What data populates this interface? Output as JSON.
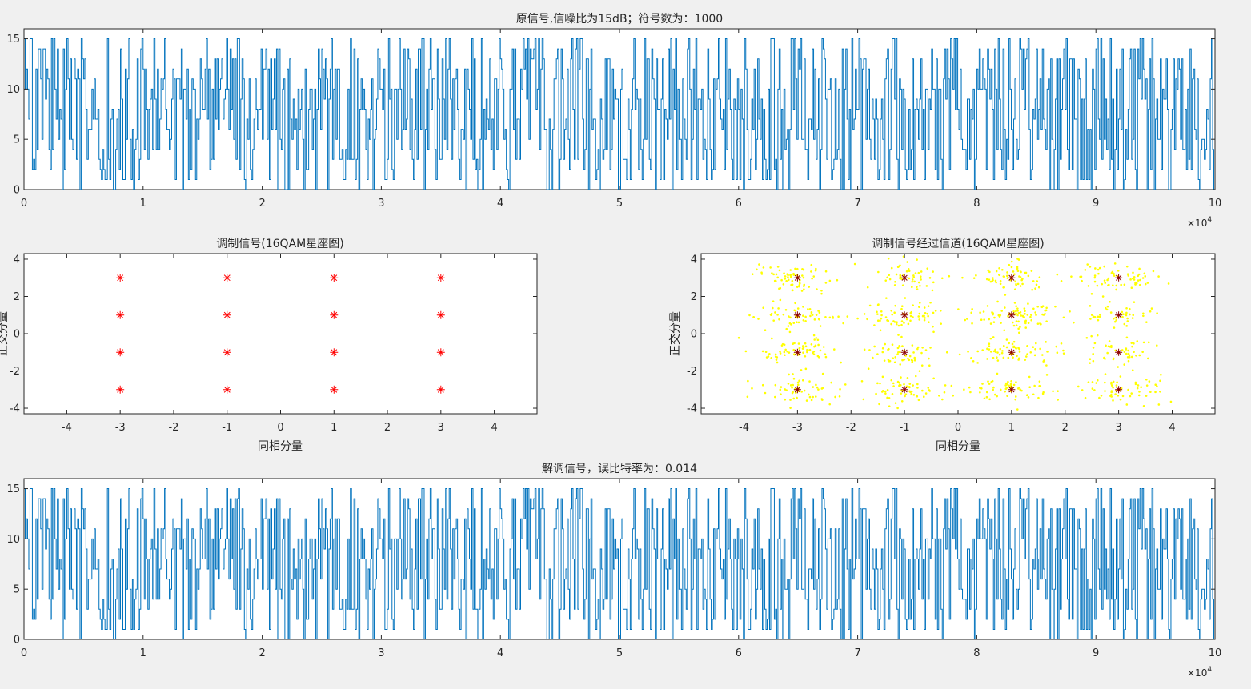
{
  "figure": {
    "background": "#f0f0f0",
    "axes_background": "#ffffff",
    "axes_color": "#262626"
  },
  "chart_data": [
    {
      "id": "original",
      "type": "line",
      "title": "原信号,信噪比为15dB；符号数为：1000",
      "xlabel": "",
      "ylabel": "",
      "xlim": [
        0,
        100000
      ],
      "ylim": [
        0,
        16
      ],
      "xticks": [
        0,
        1,
        2,
        3,
        4,
        5,
        6,
        7,
        8,
        9,
        10
      ],
      "x_exponent_base": "×10",
      "x_exponent": "4",
      "yticks": [
        0,
        5,
        10,
        15
      ],
      "color": "#0072bd",
      "symbols_count": 1000,
      "samples_per_symbol": 100,
      "value_range": [
        0,
        15
      ],
      "seed": 2718
    },
    {
      "id": "modulated",
      "type": "scatter",
      "title": "调制信号(16QAM星座图)",
      "xlabel": "同相分量",
      "ylabel": "正交分量",
      "xlim": [
        -4.8,
        4.8
      ],
      "ylim": [
        -4.3,
        4.3
      ],
      "xticks": [
        -4,
        -3,
        -2,
        -1,
        0,
        1,
        2,
        3,
        4
      ],
      "yticks": [
        -4,
        -2,
        0,
        2,
        4
      ],
      "marker": "asterisk",
      "color": "#ff0000",
      "points_i": [
        -3,
        -1,
        1,
        3
      ],
      "points_q": [
        -3,
        -1,
        1,
        3
      ]
    },
    {
      "id": "channel",
      "type": "scatter",
      "title": "调制信号经过信道(16QAM星座图)",
      "xlabel": "同相分量",
      "ylabel": "正交分量",
      "xlim": [
        -4.8,
        4.8
      ],
      "ylim": [
        -4.3,
        4.3
      ],
      "xticks": [
        -4,
        -3,
        -2,
        -1,
        0,
        1,
        2,
        3,
        4
      ],
      "yticks": [
        -4,
        -2,
        0,
        2,
        4
      ],
      "noise_color": "#ffff00",
      "ideal_color": "#8b0000",
      "noise_count": 1000,
      "noise_sigma": 0.38,
      "points_i": [
        -3,
        -1,
        1,
        3
      ],
      "points_q": [
        -3,
        -1,
        1,
        3
      ],
      "seed": 31415
    },
    {
      "id": "demodulated",
      "type": "line",
      "title": "解调信号，误比特率为：0.014",
      "xlabel": "",
      "ylabel": "",
      "xlim": [
        0,
        100000
      ],
      "ylim": [
        0,
        16
      ],
      "xticks": [
        0,
        1,
        2,
        3,
        4,
        5,
        6,
        7,
        8,
        9,
        10
      ],
      "x_exponent_base": "×10",
      "x_exponent": "4",
      "yticks": [
        0,
        5,
        10,
        15
      ],
      "color": "#0072bd",
      "symbols_count": 1000,
      "samples_per_symbol": 100,
      "value_range": [
        0,
        15
      ],
      "bit_error_rate": 0.014,
      "seed": 2718
    }
  ]
}
